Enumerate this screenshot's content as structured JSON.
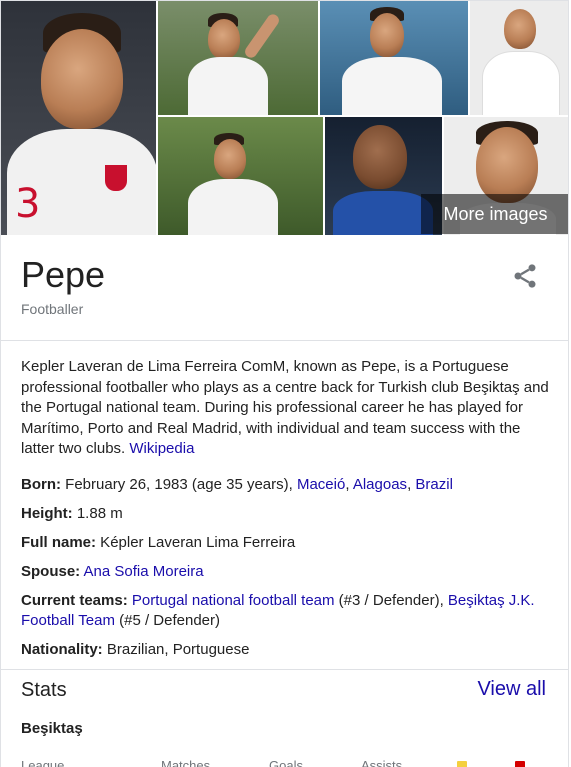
{
  "images": {
    "more_images_label": "More images",
    "tiles": [
      {
        "name": "image-pepe-portugal-shirt",
        "bg": "#3b3f46",
        "shirt": "#f2f2f2",
        "number": "3"
      },
      {
        "name": "image-pepe-celebrating-realmadrid",
        "bg": "#5d7a3e",
        "shirt": "#f4f4f4"
      },
      {
        "name": "image-pepe-realmadrid-armband",
        "bg": "#3a6a8c",
        "shirt": "#f5f5f5"
      },
      {
        "name": "image-pepe-portrait-realmadrid",
        "bg": "#ececec",
        "shirt": "#ffffff"
      },
      {
        "name": "image-pepe-fist-pump",
        "bg": "#4d6a35",
        "shirt": "#f3f3f3"
      },
      {
        "name": "image-pepe-porto-blue",
        "bg": "#1f2b3b",
        "shirt": "#2451a8"
      },
      {
        "name": "image-pepe-headshot-white",
        "bg": "#e9e9e9",
        "shirt": "#ffffff"
      }
    ]
  },
  "header": {
    "title": "Pepe",
    "subtitle": "Footballer",
    "share_icon": "share-icon"
  },
  "description": {
    "text": "Kepler Laveran de Lima Ferreira ComM, known as Pepe, is a Portuguese professional footballer who plays as a centre back for Turkish club Beşiktaş and the Portugal national team. During his professional career he has played for Marítimo, Porto and Real Madrid, with individual and team success with the latter two clubs. ",
    "source_link": "Wikipedia"
  },
  "facts": {
    "born": {
      "label": "Born:",
      "value": " February 26, 1983 (age 35 years), ",
      "links": [
        "Maceió",
        "Alagoas",
        "Brazil"
      ]
    },
    "height": {
      "label": "Height:",
      "value": " 1.88 m"
    },
    "full_name": {
      "label": "Full name:",
      "value": " Képler Laveran Lima Ferreira"
    },
    "spouse": {
      "label": "Spouse:",
      "link": "Ana Sofia Moreira"
    },
    "current_teams": {
      "label": "Current teams:",
      "link1": "Portugal national football team",
      "text1": " (#3 / Defender), ",
      "link2": "Beşiktaş J.K. Football Team",
      "text2": " (#5 / Defender)"
    },
    "nationality": {
      "label": "Nationality:",
      "value": " Brazilian, Portuguese"
    }
  },
  "stats": {
    "title": "Stats",
    "view_all": "View all",
    "team": "Beşiktaş",
    "columns": [
      "League",
      "Matches",
      "Goals",
      "Assists"
    ],
    "card_colors": {
      "yellow": "#f4d03f",
      "red": "#d50000"
    }
  },
  "colors": {
    "link": "#1a0dab",
    "secondary": "#70757a",
    "divider": "#dfe1e5"
  }
}
